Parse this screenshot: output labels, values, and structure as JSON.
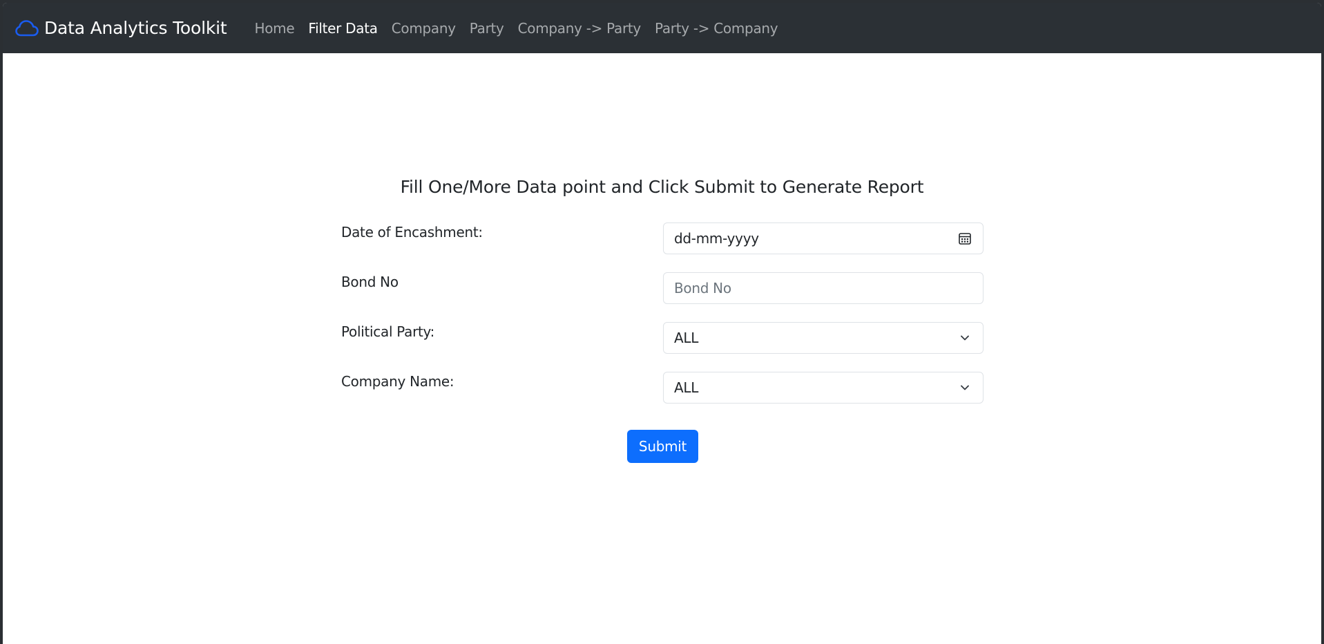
{
  "navbar": {
    "brand": "Data Analytics Toolkit",
    "brand_icon": "cloud-icon",
    "links": [
      {
        "label": "Home",
        "active": false
      },
      {
        "label": "Filter Data",
        "active": true
      },
      {
        "label": "Company",
        "active": false
      },
      {
        "label": "Party",
        "active": false
      },
      {
        "label": "Company -> Party",
        "active": false
      },
      {
        "label": "Party -> Company",
        "active": false
      }
    ]
  },
  "form": {
    "title": "Fill One/More Data point and Click Submit to Generate Report",
    "date": {
      "label": "Date of Encashment:",
      "value": "dd-mm-yyyy",
      "icon": "calendar-icon"
    },
    "bond": {
      "label": "Bond No",
      "value": "",
      "placeholder": "Bond No"
    },
    "party": {
      "label": "Political Party:",
      "selected": "ALL",
      "icon": "chevron-down-icon"
    },
    "company": {
      "label": "Company Name:",
      "selected": "ALL",
      "icon": "chevron-down-icon"
    },
    "submit_label": "Submit"
  },
  "colors": {
    "navbar_bg": "#2b3035",
    "brand_icon": "#1a5cf0",
    "primary": "#0d6efd",
    "nav_active": "#ffffff",
    "nav_inactive": "#a7aaad",
    "text": "#212529"
  }
}
